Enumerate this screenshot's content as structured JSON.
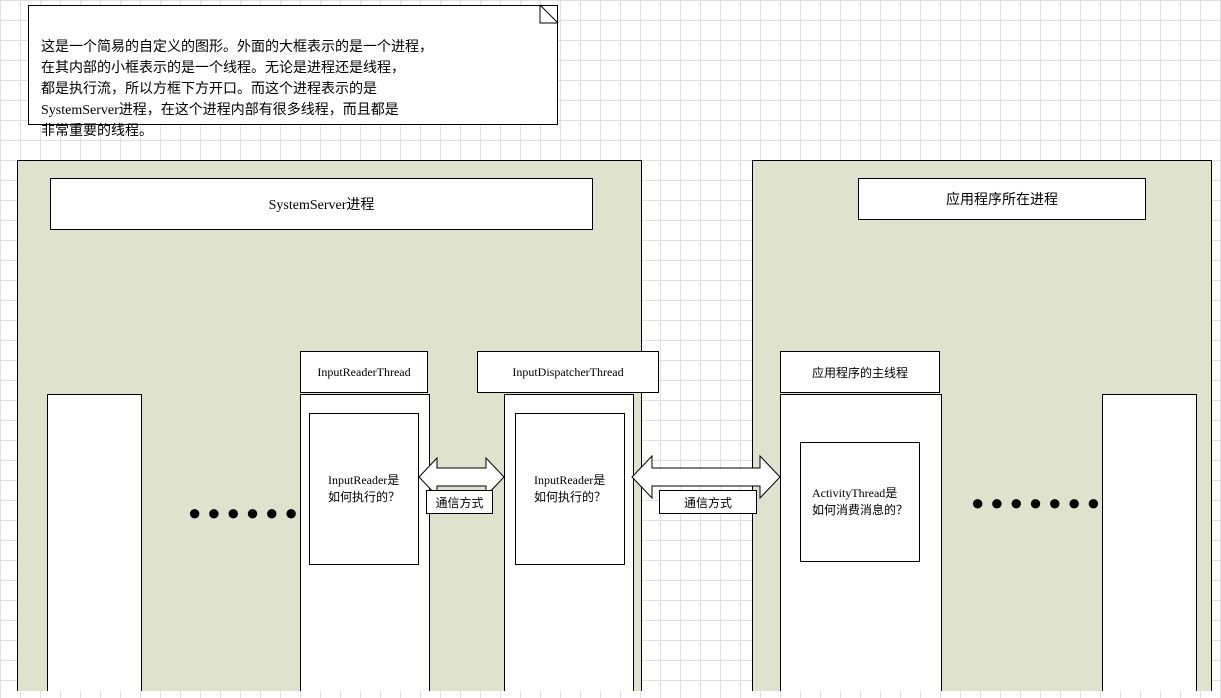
{
  "note": {
    "text": "这是一个简易的自定义的图形。外面的大框表示的是一个进程，\n在其内部的小框表示的是一个线程。无论是进程还是线程，\n都是执行流，所以方框下方开口。而这个进程表示的是\nSystemServer进程，在这个进程内部有很多线程，而且都是\n非常重要的线程。"
  },
  "processes": {
    "system_server": {
      "title": "SystemServer进程"
    },
    "app_process": {
      "title": "应用程序所在进程"
    }
  },
  "threads": {
    "input_reader": {
      "label": "InputReaderThread",
      "inner": "InputReader是\n如何执行的？"
    },
    "input_dispatcher": {
      "label": "InputDispatcherThread",
      "inner": "InputReader是\n如何执行的？"
    },
    "app_main": {
      "label": "应用程序的主线程",
      "inner": "ActivityThread是\n如何消费消息的？"
    }
  },
  "comm": {
    "c1": "通信方式",
    "c2": "通信方式"
  },
  "dots": {
    "d1": "●●●●●●",
    "d2": "●●●●●●●"
  }
}
